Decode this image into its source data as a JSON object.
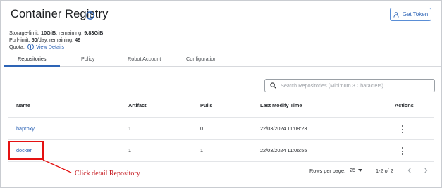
{
  "page": {
    "title": "Container Registry",
    "get_token_label": "Get Token"
  },
  "meta": {
    "storage_prefix": "Storage-limit: ",
    "storage_limit": "10GiB",
    "storage_mid": ", remaining: ",
    "storage_remaining": "9.83GiB",
    "pull_prefix": "Pull-limit: ",
    "pull_limit": "50",
    "pull_mid": "/day, remaining: ",
    "pull_remaining": "49",
    "quota_label": "Quota:",
    "view_details": "View Details"
  },
  "tabs": [
    {
      "label": "Repositories",
      "active": true
    },
    {
      "label": "Policy",
      "active": false
    },
    {
      "label": "Robot Account",
      "active": false
    },
    {
      "label": "Configuration",
      "active": false
    }
  ],
  "search": {
    "placeholder": "Search Repositories (Minimum 3 Characters)"
  },
  "table": {
    "headers": {
      "name": "Name",
      "artifact": "Artifact",
      "pulls": "Pulls",
      "last_modify": "Last Modify Time",
      "actions": "Actions"
    },
    "rows": [
      {
        "name": "haproxy",
        "artifact": "1",
        "pulls": "0",
        "last_modify": "22/03/2024 11:08:23"
      },
      {
        "name": "docker",
        "artifact": "1",
        "pulls": "1",
        "last_modify": "22/03/2024 11:06:55"
      }
    ]
  },
  "pagination": {
    "rows_per_page_label": "Rows per page:",
    "rows_per_page": "25",
    "range": "1-2 of 2"
  },
  "annotation": {
    "text": "Click detail Repository"
  },
  "colors": {
    "accent": "#2d64b6",
    "annotation": "#e41212"
  }
}
